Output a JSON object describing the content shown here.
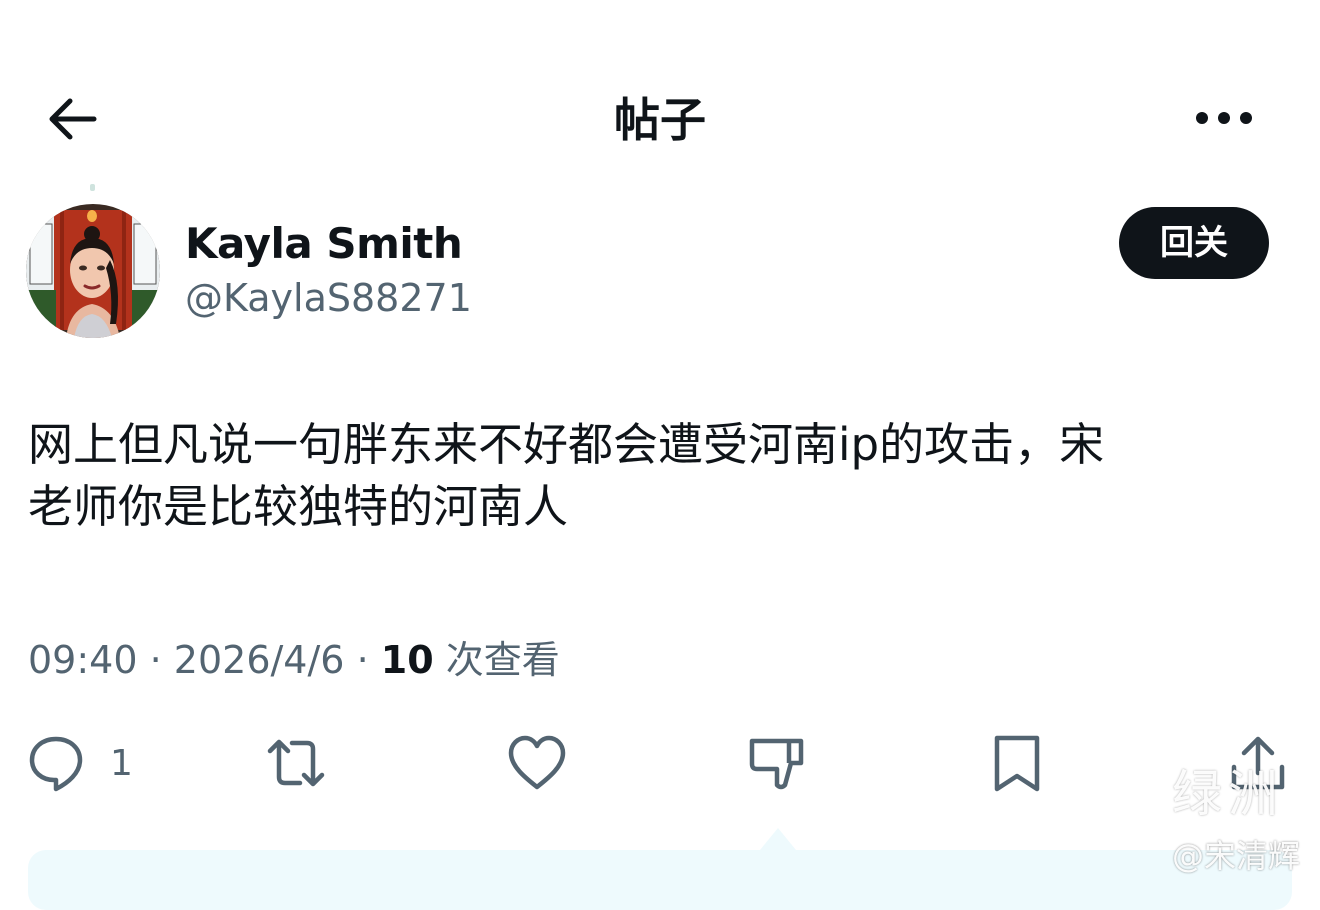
{
  "header": {
    "title": "帖子",
    "back_icon": "arrow-left-icon",
    "more_icon": "more-horizontal-icon"
  },
  "author": {
    "display_name": "Kayla Smith",
    "handle": "@KaylaS88271",
    "avatar_icon": "avatar",
    "follow_label": "回关"
  },
  "tweet": {
    "text": "网上但凡说一句胖东来不好都会遭受河南ip的攻击，宋\n老师你是比较独特的河南人"
  },
  "meta": {
    "time": "09:40",
    "separator": "·",
    "date": "2026/4/6",
    "views_count": "10",
    "views_label": "次查看"
  },
  "actions": {
    "reply_icon": "reply-icon",
    "reply_count": "1",
    "retweet_icon": "retweet-icon",
    "like_icon": "heart-icon",
    "dislike_icon": "thumbs-down-icon",
    "bookmark_icon": "bookmark-icon",
    "share_icon": "share-icon"
  },
  "watermark": {
    "logo_text": "绿洲",
    "author_tag": "@宋清辉"
  },
  "colors": {
    "text_primary": "#0f1419",
    "text_secondary": "#536471",
    "button_dark": "#0f1419",
    "bubble_bg": "#eefafd"
  }
}
